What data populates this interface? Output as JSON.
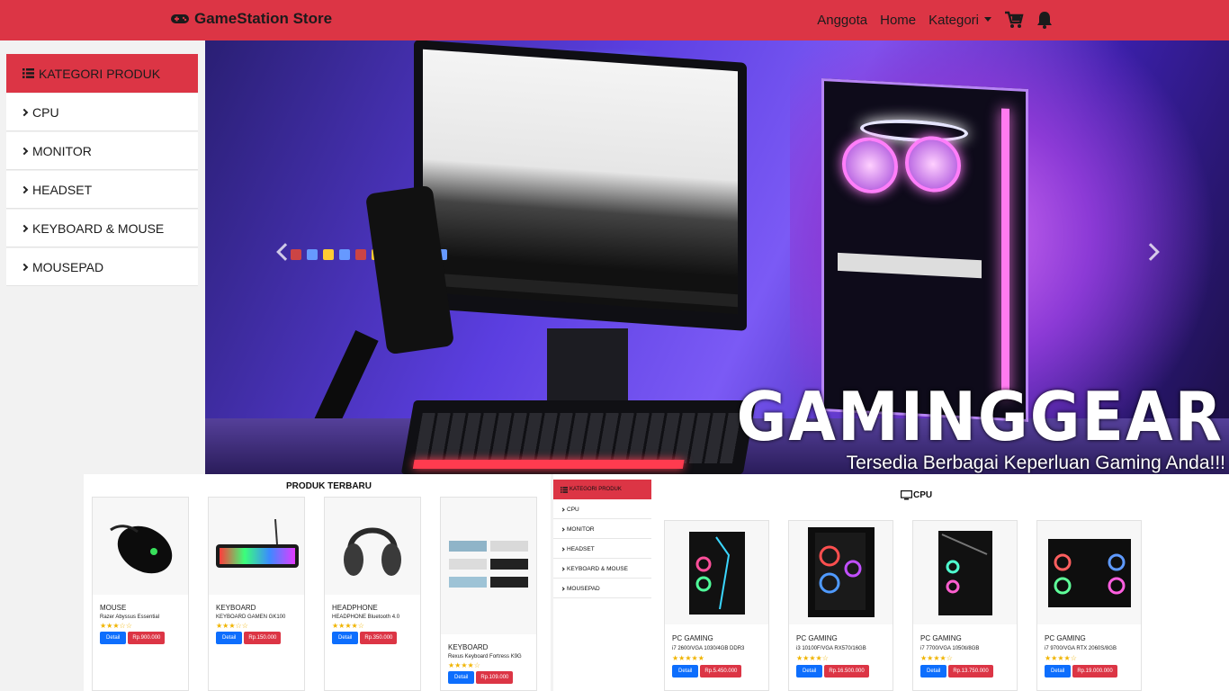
{
  "navbar": {
    "brand": "GameStation Store",
    "links": [
      "Anggota",
      "Home",
      "Kategori"
    ],
    "brand_color": "#dc3545"
  },
  "sidebar": {
    "title": "KATEGORI PRODUK",
    "items": [
      "CPU",
      "MONITOR",
      "HEADSET",
      "KEYBOARD & MOUSE",
      "MOUSEPAD"
    ]
  },
  "carousel": {
    "title": "GAMINGGEAR",
    "subtitle": "Tersedia Berbagai Keperluan Gaming Anda!!!"
  },
  "newest": {
    "title": "PRODUK TERBARU",
    "products": [
      {
        "category": "MOUSE",
        "name": "Razer Abyssus Essential",
        "stars": "★★★☆☆",
        "detail": "Detail",
        "price": "Rp.900.000"
      },
      {
        "category": "KEYBOARD",
        "name": "KEYBOARD GAMEN GK100",
        "stars": "★★★☆☆",
        "detail": "Detail",
        "price": "Rp.150.000"
      },
      {
        "category": "HEADPHONE",
        "name": "HEADPHONE Bluetooth 4.0",
        "stars": "★★★★☆",
        "detail": "Detail",
        "price": "Rp.350.000"
      },
      {
        "category": "KEYBOARD",
        "name": "Rexus Keyboard Fortress K9G",
        "stars": "★★★★☆",
        "detail": "Detail",
        "price": "Rp.109.000"
      }
    ]
  },
  "mini_sidebar": {
    "title": "KATEGORI PRODUK",
    "items": [
      "CPU",
      "MONITOR",
      "HEADSET",
      "KEYBOARD & MOUSE",
      "MOUSEPAD"
    ]
  },
  "cpu_section": {
    "title": "CPU",
    "products": [
      {
        "category": "PC GAMING",
        "name": "i7 2600/VGA 1030/4GB DDR3",
        "stars": "★★★★★",
        "detail": "Detail",
        "price": "Rp.5.450.000"
      },
      {
        "category": "PC GAMING",
        "name": "i3 10100F/VGA RX570/16GB",
        "stars": "★★★★☆",
        "detail": "Detail",
        "price": "Rp.16.500.000"
      },
      {
        "category": "PC GAMING",
        "name": "i7 7700/VGA 1050ti/8GB",
        "stars": "★★★★☆",
        "detail": "Detail",
        "price": "Rp.13.750.000"
      },
      {
        "category": "PC GAMING",
        "name": "i7 9700/VGA RTX 2060S/8GB",
        "stars": "★★★★☆",
        "detail": "Detail",
        "price": "Rp.19.000.000"
      }
    ]
  }
}
